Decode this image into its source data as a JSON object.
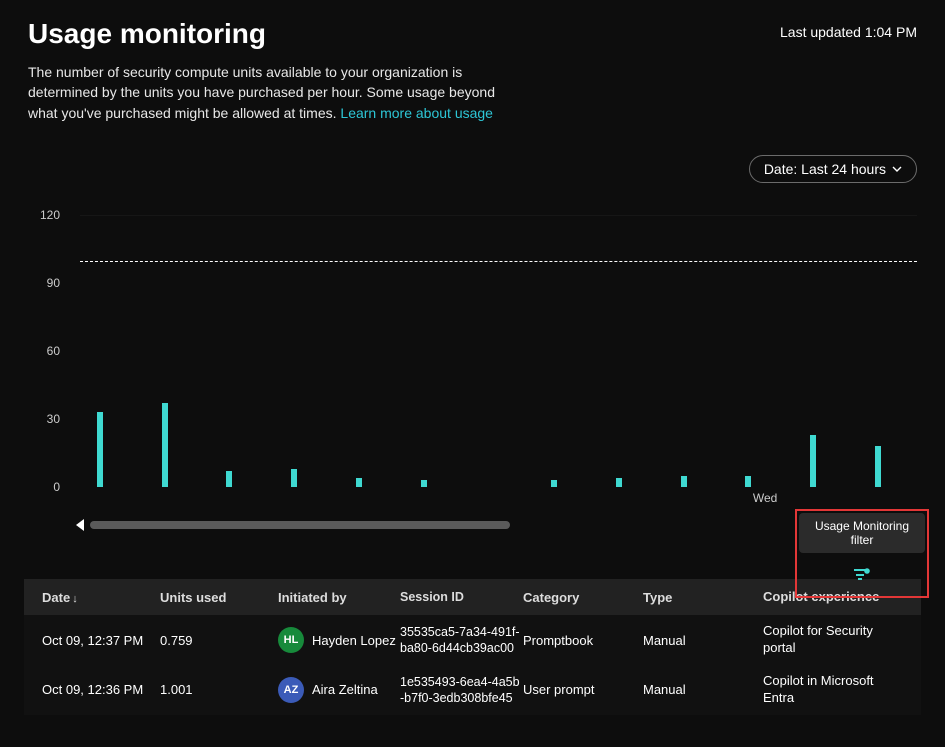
{
  "header": {
    "title": "Usage monitoring",
    "last_updated": "Last updated 1:04 PM",
    "description_1": "The number of security compute units available to your organization is determined by the units you have purchased per hour. Some usage beyond what you've purchased might be allowed at times. ",
    "learn_more": "Learn more about usage"
  },
  "controls": {
    "date_pill": "Date: Last 24 hours",
    "filter_tooltip": "Usage Monitoring filter"
  },
  "chart_data": {
    "type": "bar",
    "ylabel": "",
    "xlabel": "",
    "ylim": [
      0,
      120
    ],
    "y_ticks": [
      0,
      30,
      60,
      90,
      120
    ],
    "capacity_line": 100,
    "x_labels": [
      {
        "pos": 0.84,
        "text": "Wed"
      }
    ],
    "values": [
      33,
      37,
      7,
      8,
      4,
      3,
      0,
      3,
      4,
      5,
      5,
      23,
      18
    ]
  },
  "table": {
    "columns": {
      "date": "Date",
      "units": "Units used",
      "initiated": "Initiated by",
      "session": "Session ID",
      "category": "Category",
      "type": "Type",
      "copilot": "Copilot experience"
    },
    "rows": [
      {
        "date": "Oct 09, 12:37 PM",
        "units": "0.759",
        "avatar_initials": "HL",
        "avatar_color": "#178a3b",
        "initiated": "Hayden Lopez",
        "session": "35535ca5-7a34-491f-ba80-6d44cb39ac00",
        "category": "Promptbook",
        "type": "Manual",
        "copilot": "Copilot for Security portal"
      },
      {
        "date": "Oct 09, 12:36 PM",
        "units": "1.001",
        "avatar_initials": "AZ",
        "avatar_color": "#3b5bb8",
        "initiated": "Aira Zeltina",
        "session": "1e535493-6ea4-4a5b-b7f0-3edb308bfe45",
        "category": "User prompt",
        "type": "Manual",
        "copilot": "Copilot in Microsoft Entra"
      }
    ]
  }
}
